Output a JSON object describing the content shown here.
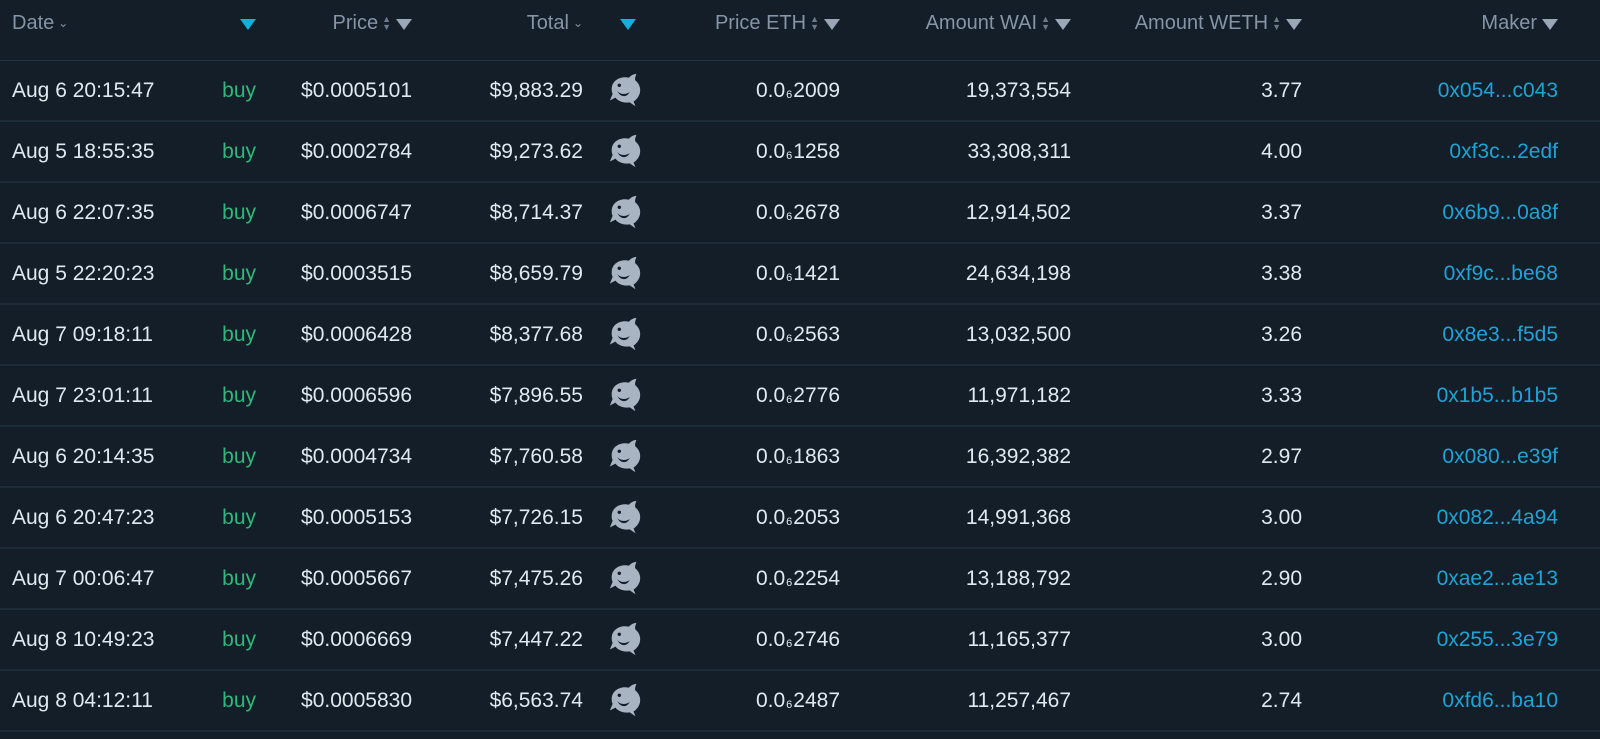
{
  "headers": {
    "date": "Date",
    "price": "Price",
    "total": "Total",
    "price_eth": "Price ETH",
    "amount_wai": "Amount WAI",
    "amount_weth": "Amount WETH",
    "maker": "Maker"
  },
  "icons": {
    "sort": "sort-arrows-icon",
    "filter": "filter-funnel-icon",
    "row": "dolphin-icon",
    "active_filter_color": "#13b0dd",
    "buy_color": "#2fb87a",
    "maker_color": "#1fa3d6"
  },
  "rows": [
    {
      "date": "Aug 6 20:15:47",
      "type": "buy",
      "price": "$0.0005101",
      "total": "$9,883.29",
      "peth_lead": "0.0",
      "peth_sub": "6",
      "peth_tail": "2009",
      "wai": "19,373,554",
      "weth": "3.77",
      "maker": "0x054...c043"
    },
    {
      "date": "Aug 5 18:55:35",
      "type": "buy",
      "price": "$0.0002784",
      "total": "$9,273.62",
      "peth_lead": "0.0",
      "peth_sub": "6",
      "peth_tail": "1258",
      "wai": "33,308,311",
      "weth": "4.00",
      "maker": "0xf3c...2edf"
    },
    {
      "date": "Aug 6 22:07:35",
      "type": "buy",
      "price": "$0.0006747",
      "total": "$8,714.37",
      "peth_lead": "0.0",
      "peth_sub": "6",
      "peth_tail": "2678",
      "wai": "12,914,502",
      "weth": "3.37",
      "maker": "0x6b9...0a8f"
    },
    {
      "date": "Aug 5 22:20:23",
      "type": "buy",
      "price": "$0.0003515",
      "total": "$8,659.79",
      "peth_lead": "0.0",
      "peth_sub": "6",
      "peth_tail": "1421",
      "wai": "24,634,198",
      "weth": "3.38",
      "maker": "0xf9c...be68"
    },
    {
      "date": "Aug 7 09:18:11",
      "type": "buy",
      "price": "$0.0006428",
      "total": "$8,377.68",
      "peth_lead": "0.0",
      "peth_sub": "6",
      "peth_tail": "2563",
      "wai": "13,032,500",
      "weth": "3.26",
      "maker": "0x8e3...f5d5"
    },
    {
      "date": "Aug 7 23:01:11",
      "type": "buy",
      "price": "$0.0006596",
      "total": "$7,896.55",
      "peth_lead": "0.0",
      "peth_sub": "6",
      "peth_tail": "2776",
      "wai": "11,971,182",
      "weth": "3.33",
      "maker": "0x1b5...b1b5"
    },
    {
      "date": "Aug 6 20:14:35",
      "type": "buy",
      "price": "$0.0004734",
      "total": "$7,760.58",
      "peth_lead": "0.0",
      "peth_sub": "6",
      "peth_tail": "1863",
      "wai": "16,392,382",
      "weth": "2.97",
      "maker": "0x080...e39f"
    },
    {
      "date": "Aug 6 20:47:23",
      "type": "buy",
      "price": "$0.0005153",
      "total": "$7,726.15",
      "peth_lead": "0.0",
      "peth_sub": "6",
      "peth_tail": "2053",
      "wai": "14,991,368",
      "weth": "3.00",
      "maker": "0x082...4a94"
    },
    {
      "date": "Aug 7 00:06:47",
      "type": "buy",
      "price": "$0.0005667",
      "total": "$7,475.26",
      "peth_lead": "0.0",
      "peth_sub": "6",
      "peth_tail": "2254",
      "wai": "13,188,792",
      "weth": "2.90",
      "maker": "0xae2...ae13"
    },
    {
      "date": "Aug 8 10:49:23",
      "type": "buy",
      "price": "$0.0006669",
      "total": "$7,447.22",
      "peth_lead": "0.0",
      "peth_sub": "6",
      "peth_tail": "2746",
      "wai": "11,165,377",
      "weth": "3.00",
      "maker": "0x255...3e79"
    },
    {
      "date": "Aug 8 04:12:11",
      "type": "buy",
      "price": "$0.0005830",
      "total": "$6,563.74",
      "peth_lead": "0.0",
      "peth_sub": "6",
      "peth_tail": "2487",
      "wai": "11,257,467",
      "weth": "2.74",
      "maker": "0xfd6...ba10"
    }
  ]
}
